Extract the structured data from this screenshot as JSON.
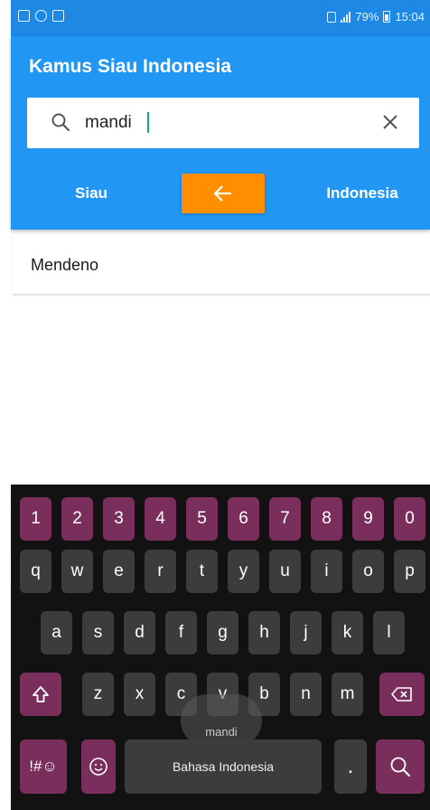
{
  "status_bar": {
    "left_icons": [
      "gallery-icon",
      "sync-icon",
      "wifi-download-icon"
    ],
    "battery": "79%",
    "time": "15:04"
  },
  "app": {
    "title": "Kamus Siau Indonesia"
  },
  "search": {
    "value": "mandi",
    "placeholder": ""
  },
  "language": {
    "source": "Siau",
    "target": "Indonesia",
    "swap_icon": "arrow-left-icon"
  },
  "results": [
    {
      "word": "Mendeno"
    }
  ],
  "colors": {
    "primary": "#2196f3",
    "status_bar": "#1e88e5",
    "accent": "#ff8f00",
    "key_special": "#7a2e5c",
    "key_normal": "#3c3c3e",
    "keyboard_bg": "#121212"
  },
  "keyboard": {
    "number_row": [
      "1",
      "2",
      "3",
      "4",
      "5",
      "6",
      "7",
      "8",
      "9",
      "0"
    ],
    "row1": [
      "q",
      "w",
      "e",
      "r",
      "t",
      "y",
      "u",
      "i",
      "o",
      "p"
    ],
    "row2": [
      "a",
      "s",
      "d",
      "f",
      "g",
      "h",
      "j",
      "k",
      "l"
    ],
    "row3": [
      "z",
      "x",
      "c",
      "v",
      "b",
      "n",
      "m"
    ],
    "symbols_label": "!#☺",
    "space_label": "Bahasa Indonesia",
    "period_label": ".",
    "suggestion": "mandi"
  }
}
